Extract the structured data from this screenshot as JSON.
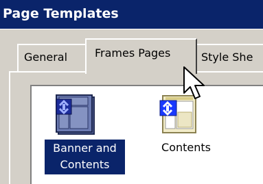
{
  "window": {
    "title": "Page Templates"
  },
  "tabs": [
    {
      "label": "General",
      "active": false
    },
    {
      "label": "Frames Pages",
      "active": true
    },
    {
      "label": "Style She",
      "active": false
    }
  ],
  "templates": [
    {
      "label_line1": "Banner and",
      "label_line2": "Contents",
      "selected": true,
      "icon": "frames-banner-contents-icon"
    },
    {
      "label": "Contents",
      "selected": false,
      "icon": "frames-contents-icon"
    }
  ],
  "colors": {
    "titlebar": "#0a246a",
    "selection": "#0a246a",
    "face": "#d4d0c8"
  }
}
